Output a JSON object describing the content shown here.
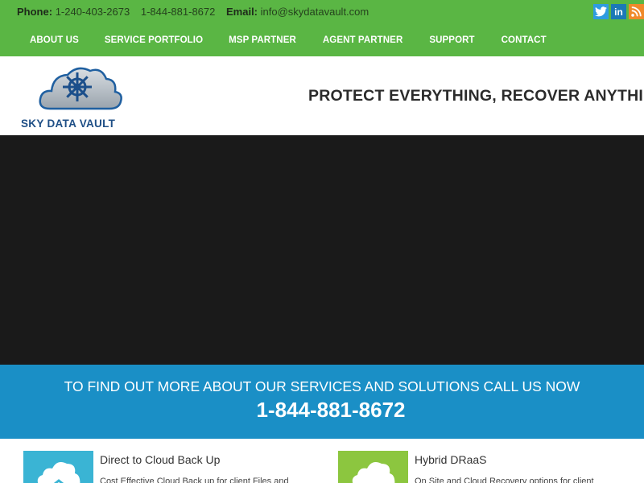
{
  "topbar": {
    "phone_label": "Phone:",
    "phone_1": "1-240-403-2673",
    "phone_2": "1-844-881-8672",
    "email_label": "Email:",
    "email": "info@skydatavault.com",
    "social": [
      {
        "icon": "twitter-icon"
      },
      {
        "icon": "linkedin-icon",
        "glyph": "in"
      },
      {
        "icon": "rss-icon"
      }
    ],
    "colors": {
      "bar": "#5ab644",
      "twitter": "#2f9be0",
      "linkedin": "#1c79b6",
      "rss": "#f08a2a"
    }
  },
  "nav": {
    "items": [
      {
        "label": "ABOUT US"
      },
      {
        "label": "SERVICE PORTFOLIO"
      },
      {
        "label": "MSP PARTNER"
      },
      {
        "label": "AGENT PARTNER"
      },
      {
        "label": "SUPPORT"
      },
      {
        "label": "CONTACT"
      }
    ]
  },
  "header": {
    "logo_text": "SKY DATA VAULT",
    "tagline": "PROTECT EVERYTHING, RECOVER ANYTHING"
  },
  "banner": {
    "text": "TO FIND OUT MORE ABOUT OUR SERVICES AND SOLUTIONS CALL US NOW",
    "phone": "1-844-881-8672",
    "color": "#1a8fc6"
  },
  "services": [
    {
      "title": "Direct to Cloud Back Up",
      "desc": "Cost Effective Cloud Back up for client Files and",
      "color": "#3ab4d4",
      "icon": "cloud-backup-icon"
    },
    {
      "title": "Hybrid DRaaS",
      "desc": "On Site and Cloud Recovery options for client",
      "color": "#8cc63f",
      "icon": "cloud-hybrid-icon"
    }
  ]
}
